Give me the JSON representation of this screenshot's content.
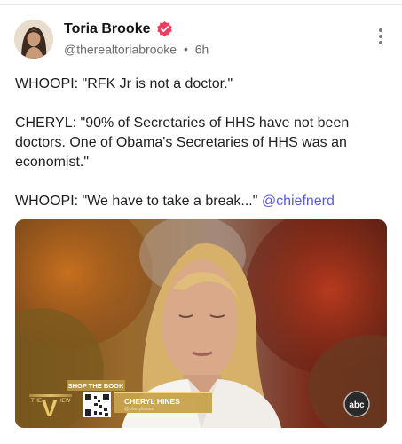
{
  "author": {
    "name": "Toria Brooke",
    "handle": "@therealtoriabrooke",
    "separator": "•",
    "time": "6h",
    "avatar_icon": "avatar-photo",
    "verified_icon": "verified-badge-icon",
    "verified_color": "#ef3d5c"
  },
  "post": {
    "paragraphs": [
      "WHOOPI: \"RFK Jr is not a doctor.\"",
      "CHERYL: \"90% of Secretaries of HHS have not been doctors. One of Obama's Secretaries of HHS was an economist.\""
    ],
    "last_text": "WHOOPI: \"We have to take a break...\" ",
    "mention": "@chiefnerd",
    "mention_color": "#5b5bd6"
  },
  "media": {
    "banner": "SHOP THE BOOK",
    "show_left": "THE",
    "show_letter": "V",
    "show_right": "IEW",
    "lower_third_name": "CHERYL HINES",
    "lower_third_handle": "@cherylhines",
    "network": "abc"
  },
  "colors": {
    "background": "#ffffff",
    "name": "#141414",
    "meta": "#6b6b70"
  }
}
